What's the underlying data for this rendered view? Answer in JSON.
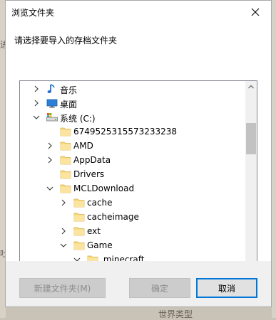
{
  "dialog": {
    "title": "浏览文件夹",
    "prompt": "请选择要导入的存档文件夹"
  },
  "tree": {
    "rows": [
      {
        "label": "音乐",
        "icon": "music-note-icon",
        "expander": "collapsed",
        "level": 1
      },
      {
        "label": "桌面",
        "icon": "desktop-icon",
        "expander": "collapsed",
        "level": 1
      },
      {
        "label": "系统 (C:)",
        "icon": "drive-icon",
        "expander": "expanded",
        "level": 1
      },
      {
        "label": "6749525315573233238",
        "icon": "folder-icon",
        "expander": "none",
        "level": 2
      },
      {
        "label": "AMD",
        "icon": "folder-icon",
        "expander": "collapsed",
        "level": 2
      },
      {
        "label": "AppData",
        "icon": "folder-icon",
        "expander": "collapsed",
        "level": 2
      },
      {
        "label": "Drivers",
        "icon": "folder-icon",
        "expander": "none",
        "level": 2
      },
      {
        "label": "MCLDownload",
        "icon": "folder-icon",
        "expander": "expanded",
        "level": 2
      },
      {
        "label": "cache",
        "icon": "folder-icon",
        "expander": "collapsed",
        "level": 3
      },
      {
        "label": "cacheimage",
        "icon": "folder-icon",
        "expander": "none",
        "level": 3
      },
      {
        "label": "ext",
        "icon": "folder-icon",
        "expander": "collapsed",
        "level": 3
      },
      {
        "label": "Game",
        "icon": "folder-icon",
        "expander": "expanded",
        "level": 3
      },
      {
        "label": ".minecraft",
        "icon": "folder-icon",
        "expander": "expanded",
        "level": 4
      }
    ]
  },
  "buttons": {
    "new_folder": "新建文件夹(M)",
    "ok": "确定",
    "cancel": "取消"
  },
  "background": {
    "left_glyph_1": "进",
    "left_glyph_2": "吐",
    "bottom_text": "世界类型"
  },
  "colors": {
    "folder": "#f8d775",
    "accent": "#0078d7"
  }
}
